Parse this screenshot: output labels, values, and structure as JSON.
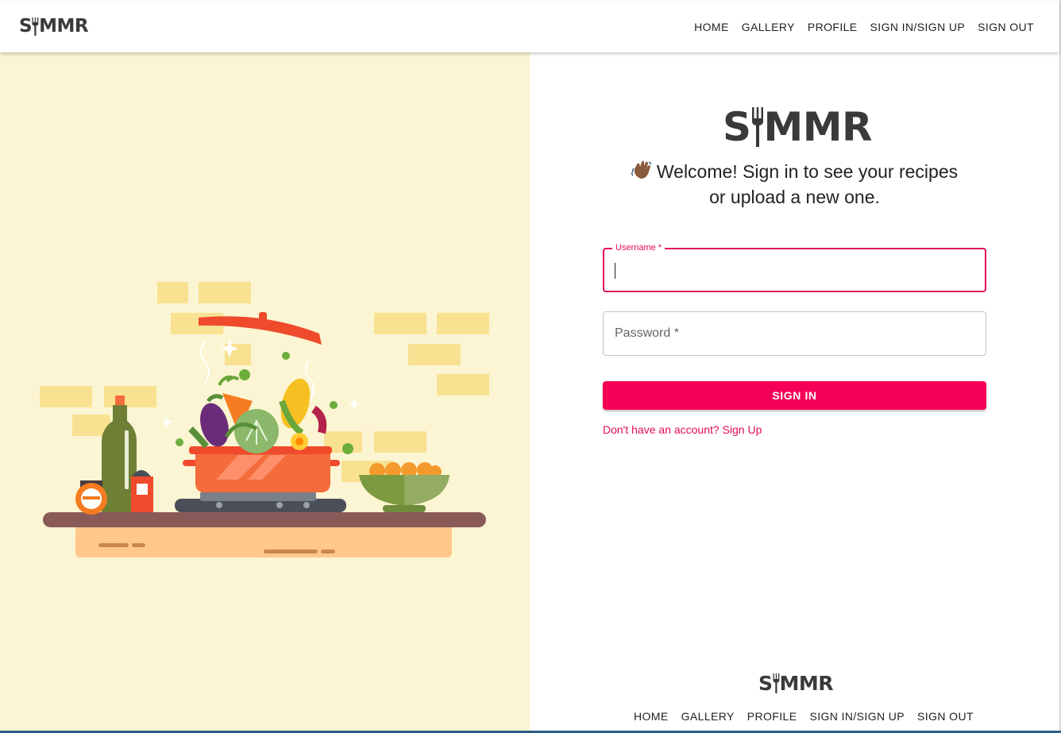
{
  "brand": {
    "name_prefix": "S",
    "name_suffix": "MMR"
  },
  "header": {
    "nav": [
      "HOME",
      "GALLERY",
      "PROFILE",
      "SIGN IN/SIGN UP",
      "SIGN OUT"
    ]
  },
  "signin": {
    "welcome_line1": "Welcome! Sign in to see your recipes",
    "welcome_line2": "or upload a new one.",
    "username_label": "Username *",
    "username_value": "",
    "password_placeholder": "Password *",
    "submit_label": "SIGN IN",
    "signup_link": "Don't have an account? Sign Up",
    "accent_color": "#f50057"
  },
  "footer": {
    "nav": [
      "HOME",
      "GALLERY",
      "PROFILE",
      "SIGN IN/SIGN UP",
      "SIGN OUT"
    ]
  },
  "illustration": {
    "icon": "cooking-pot-illustration",
    "background": "#fbf5d3"
  }
}
